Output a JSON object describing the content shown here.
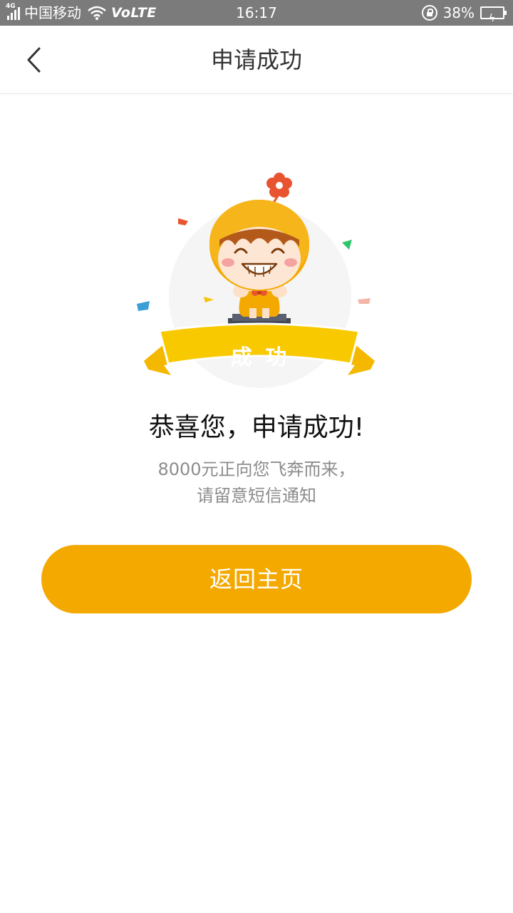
{
  "status_bar": {
    "network": "4G",
    "carrier": "中国移动",
    "volte": "VoLTE",
    "time": "16:17",
    "battery_percent": "38%",
    "battery_level": 0.38,
    "battery_color": "#2ecc55"
  },
  "nav": {
    "back_icon": "chevron-left-icon",
    "title": "申请成功"
  },
  "illustration": {
    "banner_text": "成 功",
    "accent_color": "#f4a901"
  },
  "result": {
    "headline": "恭喜您，申请成功!",
    "desc_line1": "8000元正向您飞奔而来，",
    "desc_line2": "请留意短信通知"
  },
  "actions": {
    "home_button": "返回主页",
    "button_color": "#f4a901"
  }
}
